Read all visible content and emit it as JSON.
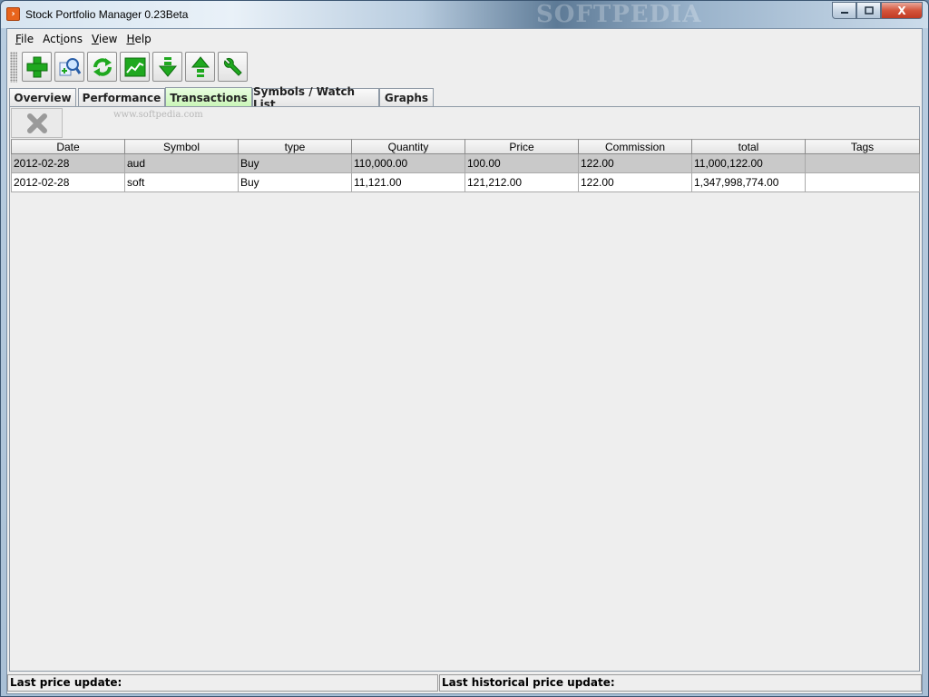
{
  "window": {
    "title": "Stock Portfolio Manager 0.23Beta",
    "watermark": "SOFTPEDIA",
    "controls": {
      "minimize": "▭",
      "maximize": "□",
      "close": "X"
    }
  },
  "menu": {
    "file": {
      "mnemonic": "F",
      "rest": "ile"
    },
    "actions": {
      "pre": "Act",
      "mnemonic": "i",
      "rest": "ons"
    },
    "view": {
      "mnemonic": "V",
      "rest": "iew"
    },
    "help": {
      "mnemonic": "H",
      "rest": "elp"
    }
  },
  "toolbar": {
    "icons": [
      "add-icon",
      "find-symbol-icon",
      "refresh-icon",
      "chart-icon",
      "download-icon",
      "upload-icon",
      "tools-icon"
    ],
    "accent": "#1fa81f"
  },
  "tabs": [
    {
      "label": "Overview",
      "active": false
    },
    {
      "label": "Performance",
      "active": false
    },
    {
      "label": "Transactions",
      "active": true
    },
    {
      "label": "Symbols / Watch List",
      "active": false
    },
    {
      "label": "Graphs",
      "active": false
    }
  ],
  "transactions": {
    "watermark": "www.softpedia.com",
    "delete_icon": "delete-icon",
    "columns": [
      "Date",
      "Symbol",
      "type",
      "Quantity",
      "Price",
      "Commission",
      "total",
      "Tags"
    ],
    "rows": [
      {
        "date": "2012-02-28",
        "symbol": "aud",
        "type": "Buy",
        "quantity": "110,000.00",
        "price": "100.00",
        "commission": "122.00",
        "total": "11,000,122.00",
        "tags": ""
      },
      {
        "date": "2012-02-28",
        "symbol": "soft",
        "type": "Buy",
        "quantity": "11,121.00",
        "price": "121,212.00",
        "commission": "122.00",
        "total": "1,347,998,774.00",
        "tags": ""
      }
    ],
    "selected_row": 0
  },
  "status": {
    "last_price": "Last price update:",
    "last_historical": "Last historical price update:"
  }
}
